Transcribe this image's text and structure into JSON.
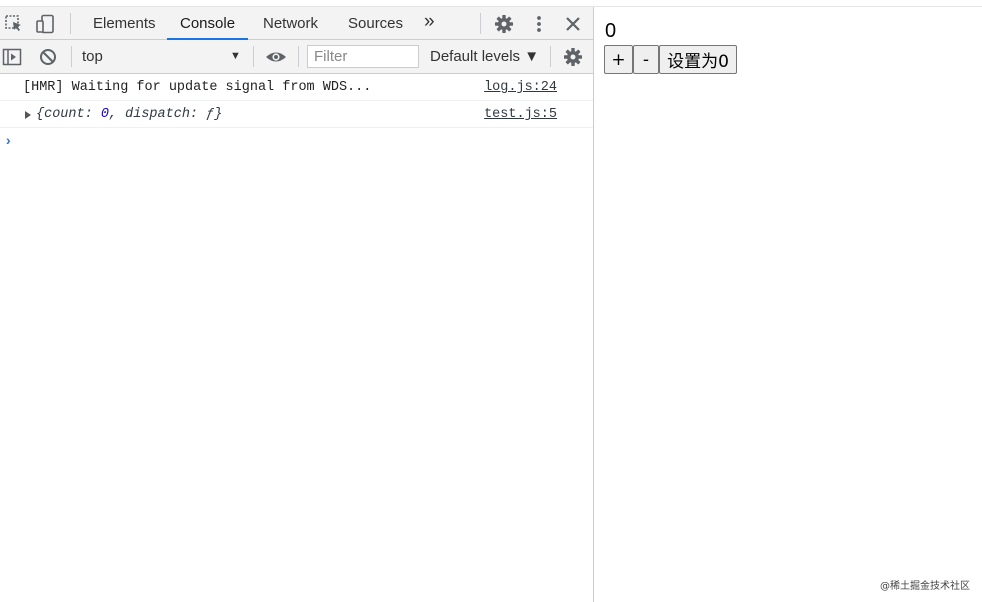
{
  "devtools": {
    "tabs": [
      "Elements",
      "Console",
      "Network",
      "Sources"
    ],
    "active_tab": "Console",
    "more_tabs_label": "»",
    "toolbar": {
      "context": "top",
      "filter_placeholder": "Filter",
      "levels_label": "Default levels ▼"
    },
    "messages": [
      {
        "text": "[HMR] Waiting for update signal from WDS...",
        "source": "log.js:24"
      },
      {
        "text_parts": {
          "open": "{count: ",
          "count": "0",
          "rest": ", dispatch: ƒ}"
        },
        "source": "test.js:5"
      }
    ],
    "prompt": "›"
  },
  "app": {
    "count": "0",
    "plus_label": "+",
    "minus_label": "-",
    "reset_label": "设置为0"
  },
  "watermark": "@稀土掘金技术社区"
}
